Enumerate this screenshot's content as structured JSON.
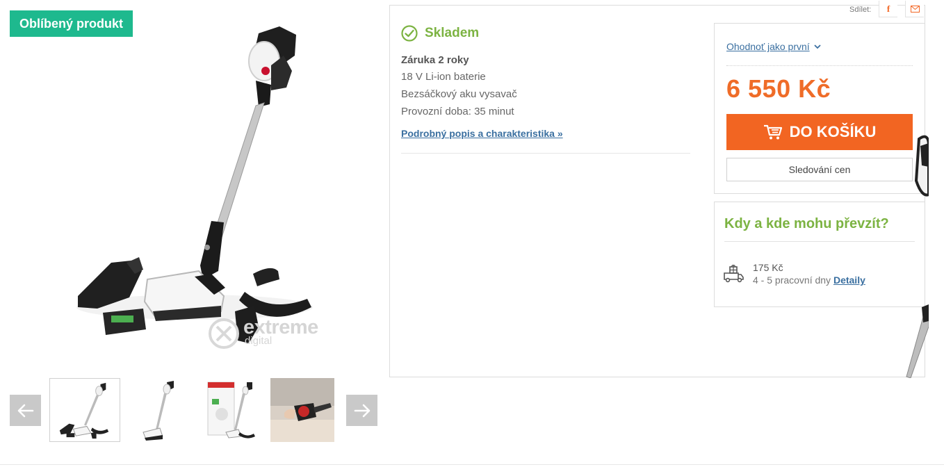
{
  "badge": {
    "label": "Oblíbený produkt"
  },
  "watermark": {
    "brand": "extreme",
    "sub": "digital"
  },
  "gallery": {
    "prev_icon": "arrow-left-icon",
    "next_icon": "arrow-right-icon",
    "thumbnails": [
      {
        "name": "thumb-vacuum-set",
        "active": true
      },
      {
        "name": "thumb-vacuum-side",
        "active": false
      },
      {
        "name": "thumb-vacuum-box",
        "active": false
      },
      {
        "name": "thumb-vacuum-handheld",
        "active": false
      }
    ]
  },
  "share": {
    "label": "Sdílet:",
    "facebook_icon": "facebook-icon",
    "mail_icon": "mail-icon"
  },
  "stock": {
    "label": "Skladem",
    "icon": "check-circle-icon"
  },
  "features": {
    "warranty": "Záruka 2 roky",
    "items": [
      "18 V Li-ion baterie",
      "Bezsáčkový aku vysavač",
      "Provozní doba: 35 minut"
    ]
  },
  "detail_link": "Podrobný popis a charakteristika »",
  "buy": {
    "rate_label": "Ohodnoť jako první",
    "rate_chevron": "chevron-down-icon",
    "price": "6 550 Kč",
    "cart_label": "DO KOŠÍKU",
    "cart_icon": "cart-icon",
    "watch_label": "Sledování cen"
  },
  "pickup": {
    "title": "Kdy a kde mohu převzít?",
    "icon": "delivery-truck-icon",
    "price": "175 Kč",
    "time": "4 - 5 pracovní dny",
    "detail_label": "Detaily"
  },
  "colors": {
    "badge": "#1eb98e",
    "stock": "#7cb342",
    "price": "#ef6c28",
    "cart": "#f26522",
    "link": "#3a6fa0"
  }
}
